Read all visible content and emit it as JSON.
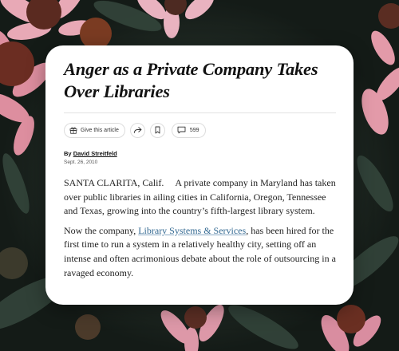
{
  "article": {
    "headline": "Anger as a Private Company Takes Over Libraries",
    "toolbar": {
      "gift_label": "Give this article",
      "share_icon": "share-icon",
      "bookmark_icon": "bookmark-icon",
      "comments_icon": "comment-icon",
      "comments_count": "599"
    },
    "byline_prefix": "By",
    "author": "David Streitfeld",
    "date": "Sept. 26, 2010",
    "paragraph1": {
      "dateline": "SANTA CLARITA, Calif.",
      "text": "A private company in Maryland has taken over public libraries in ailing cities in California, Oregon, Tennessee and Texas, growing into the country’s fifth-largest library system."
    },
    "paragraph2": {
      "before_link": "Now the company,",
      "link_text": "Library Systems & Services",
      "after_link": ", has been hired for the first time to run a system in a relatively healthy city, setting off an intense and often acrimonious debate about the role of outsourcing in a ravaged economy."
    }
  },
  "colors": {
    "link": "#326891",
    "background": "#1f2a24",
    "card": "#ffffff"
  }
}
